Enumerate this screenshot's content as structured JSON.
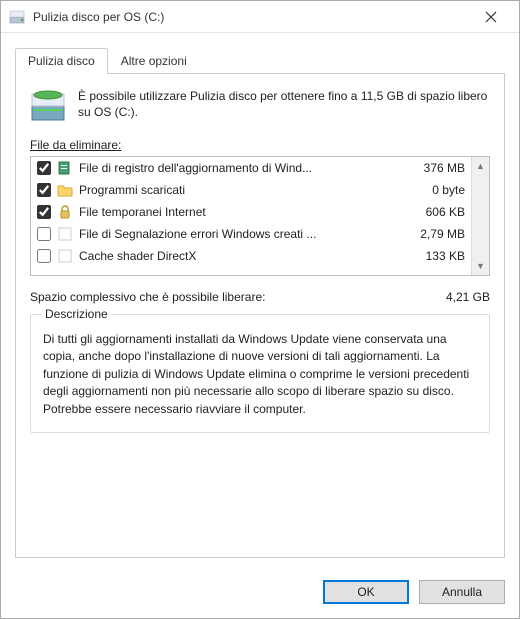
{
  "titlebar": {
    "title": "Pulizia disco per OS (C:)"
  },
  "tabs": {
    "tab1": "Pulizia disco",
    "tab2": "Altre opzioni"
  },
  "intro": "È possibile utilizzare Pulizia disco per ottenere fino a 11,5 GB di spazio libero su OS (C:).",
  "files_label": "File da eliminare:",
  "files": [
    {
      "checked": true,
      "icon": "doc-icon",
      "name": "File di registro dell'aggiornamento di Wind...",
      "size": "376 MB"
    },
    {
      "checked": true,
      "icon": "folder-icon",
      "name": "Programmi scaricati",
      "size": "0 byte"
    },
    {
      "checked": true,
      "icon": "lock-icon",
      "name": "File temporanei Internet",
      "size": "606 KB"
    },
    {
      "checked": false,
      "icon": "blank-icon",
      "name": "File di Segnalazione errori Windows creati ...",
      "size": "2,79 MB"
    },
    {
      "checked": false,
      "icon": "blank-icon",
      "name": "Cache shader DirectX",
      "size": "133 KB"
    }
  ],
  "totals": {
    "label": "Spazio complessivo che è possibile liberare:",
    "value": "4,21 GB"
  },
  "description": {
    "legend": "Descrizione",
    "body": "Di tutti gli aggiornamenti installati da Windows Update viene conservata una copia, anche dopo l'installazione di nuove versioni di tali aggiornamenti. La funzione di pulizia di Windows Update elimina o comprime le versioni precedenti degli aggiornamenti non più necessarie allo scopo di liberare spazio su disco. Potrebbe essere necessario riavviare il computer."
  },
  "buttons": {
    "ok": "OK",
    "cancel": "Annulla"
  }
}
